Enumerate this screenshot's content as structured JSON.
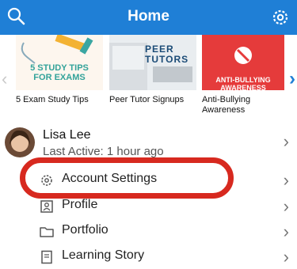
{
  "header": {
    "title": "Home"
  },
  "carousel": {
    "cards": [
      {
        "caption": "5 Exam Study Tips",
        "thumb_text": "5 STUDY TIPS\nFOR EXAMS"
      },
      {
        "caption": "Peer Tutor Signups",
        "thumb_text": "PEER\nTUTORS"
      },
      {
        "caption": "Anti-Bullying Awareness",
        "thumb_text": "ANTI-BULLYING\nAWARENESS"
      }
    ]
  },
  "profile": {
    "name": "Lisa Lee",
    "last_active": "Last Active: 1 hour ago"
  },
  "menu": {
    "items": [
      {
        "label": "Account Settings"
      },
      {
        "label": "Profile"
      },
      {
        "label": "Portfolio"
      },
      {
        "label": "Learning Story"
      }
    ]
  },
  "colors": {
    "header": "#1f7fd6",
    "highlight": "#d7291f",
    "card_red": "#e53b3b"
  }
}
